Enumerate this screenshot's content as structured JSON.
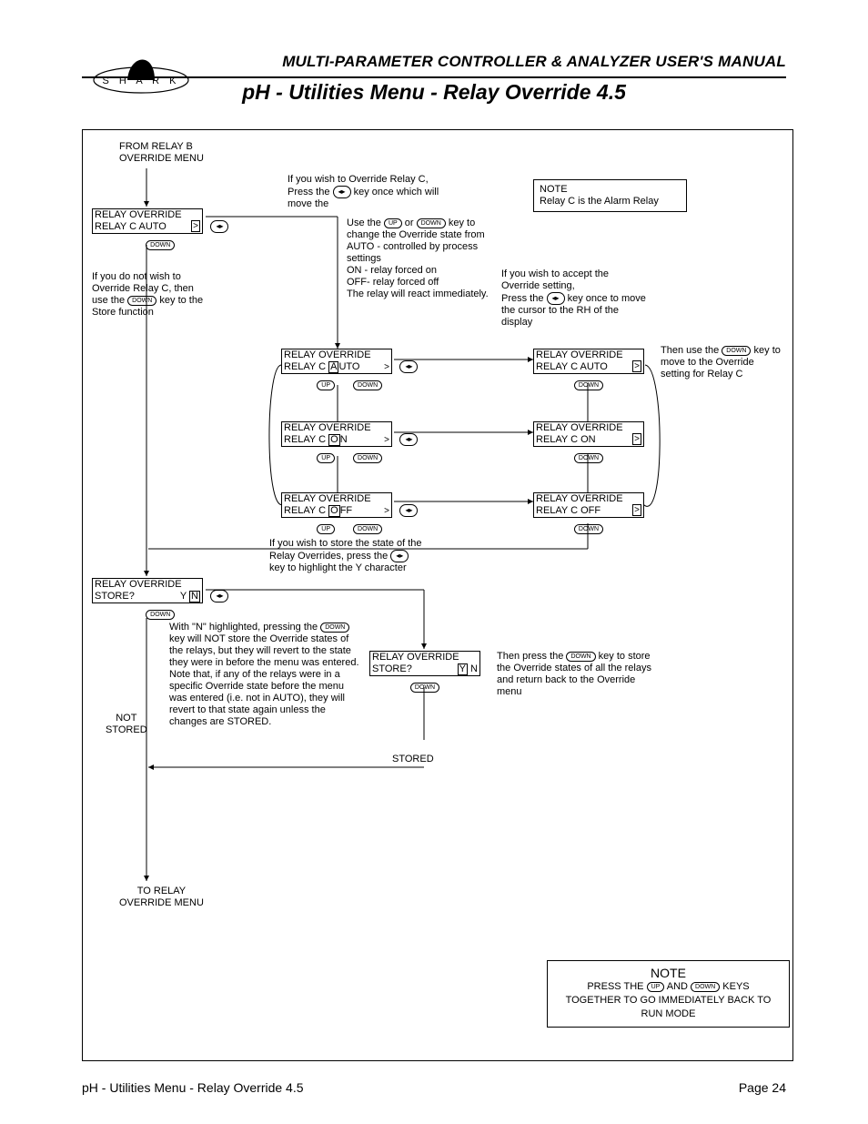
{
  "header": {
    "title": "MULTI-PARAMETER CONTROLLER & ANALYZER USER'S MANUAL",
    "subtitle": "pH - Utilities Menu - Relay Override 4.5"
  },
  "logo": {
    "letters": "S H A R K"
  },
  "entry": {
    "from": "FROM RELAY B\nOVERRIDE MENU"
  },
  "keys": {
    "up": "UP",
    "down": "DOWN",
    "enter_glyph": "◂▸"
  },
  "lcd": {
    "override_title": "RELAY OVERRIDE",
    "relay_c_auto": "RELAY  C  AUTO",
    "relay_c_auto_cursor": {
      "prefix": "RELAY  C  ",
      "hl": "A",
      "suffix": "UTO"
    },
    "relay_c_on_cursor": {
      "prefix": "RELAY  C  ",
      "hl": "O",
      "suffix": "N"
    },
    "relay_c_off_cursor": {
      "prefix": "RELAY  C  ",
      "hl": "O",
      "suffix": "FF"
    },
    "relay_c_on": "RELAY  C  ON",
    "relay_c_off": "RELAY  C  OFF",
    "store_q": "STORE?",
    "yn_y_hl": {
      "left": "",
      "hl": "Y",
      "right": " N"
    },
    "yn_n_hl": {
      "left": "Y ",
      "hl": "N",
      "right": ""
    },
    "caret": ">"
  },
  "text": {
    "instr_override_c": "If you wish to Override Relay C, Press the",
    "instr_override_c_tail": "key once which will move the",
    "no_override": "If you do not wish to Override Relay C, then use the",
    "no_override_tail": "key to the Store function",
    "use_updown": "Use the",
    "use_updown_mid": "or",
    "use_updown_tail": "key to change the Override state from AUTO - controlled by process settings\nON - relay forced on\nOFF- relay forced off\nThe relay will react immediately.",
    "accept": "If you wish to accept the Override setting,\nPress the",
    "accept_tail": "key once to move the cursor to the RH of the display",
    "then_down": "Then use the",
    "then_down_tail": "key to move to the Override setting for Relay C",
    "store_intro": "If you wish to store the state of the Relay Overrides, press the",
    "store_intro_tail": "key to highlight the Y character",
    "n_explain": "With \"N\" highlighted, pressing the",
    "n_explain_tail": "key will NOT store the Override states of the relays, but they will revert to the state they were in before the menu was entered. Note that, if any of the relays were in a specific Override state before the menu was entered (i.e. not in AUTO), they will revert to that state again unless the changes are STORED.",
    "then_press_down": "Then press the",
    "then_press_down_tail": "key to store the Override states of all the relays and return back to the Override menu",
    "not_stored": "NOT\nSTORED",
    "stored": "STORED",
    "to_menu": "TO RELAY\nOVERRIDE MENU"
  },
  "notes": {
    "top_title": "NOTE",
    "top_body": "Relay C is the Alarm Relay",
    "bottom_title": "NOTE",
    "bottom_line1_a": "PRESS THE",
    "bottom_line1_b": "AND",
    "bottom_line1_c": "KEYS",
    "bottom_line2": "TOGETHER TO GO IMMEDIATELY BACK TO",
    "bottom_line3": "RUN MODE"
  },
  "footer": {
    "left": "pH - Utilities Menu - Relay Override 4.5",
    "right": "Page 24"
  }
}
